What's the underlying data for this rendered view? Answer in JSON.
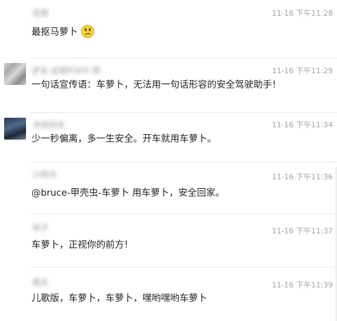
{
  "comments": [
    {
      "name": "佳宸",
      "time": "11-16 下午11:28",
      "text": "最抠马萝卜",
      "emoji": "confused-face-icon"
    },
    {
      "name": "驴友·启宸R30X·用",
      "time": "11-16 下午11:29",
      "text": "一句话宣传语：车萝卜，无法用一句话形容的安全驾驶助手！"
    },
    {
      "name": "寻找阿东",
      "time": "11-16 下午11:34",
      "text": "少一秒偏离，多一生安全。开车就用车萝卜。"
    },
    {
      "name": "小雨点",
      "time": "11-16 下午11:36",
      "text": "@bruce-甲壳虫-车萝卜 用车萝卜，安全回家。"
    },
    {
      "name": "林子",
      "time": "11-16 下午11:37",
      "text": "车萝卜，正视你的前方！"
    },
    {
      "name": "晴天",
      "time": "11-16 下午11:39",
      "text": "儿歌版，车萝卜，车萝卜，嘿哟嘿哟车萝卜"
    }
  ]
}
